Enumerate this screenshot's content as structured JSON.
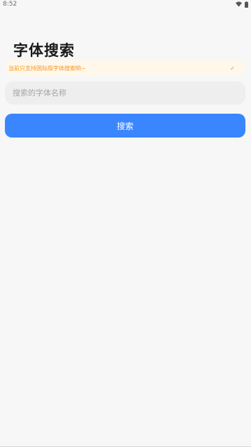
{
  "status_bar": {
    "time": "8:52",
    "icons": [
      "wifi-icon",
      "battery-icon"
    ]
  },
  "page": {
    "title": "字体搜索"
  },
  "notice": {
    "text": "当前只支持国际版字体搜索哟~",
    "icon": "check-icon",
    "text_color": "#f49b24",
    "background": "#fff7ea"
  },
  "search": {
    "placeholder": "搜索的字体名称",
    "value": ""
  },
  "actions": {
    "search_label": "搜索",
    "button_color": "#3a86fe"
  }
}
